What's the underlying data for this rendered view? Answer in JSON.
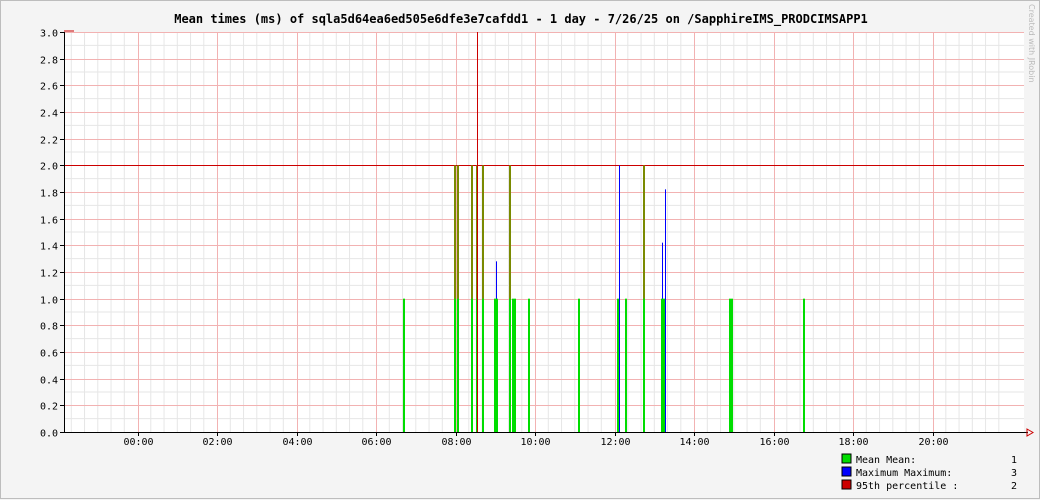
{
  "chart_data": {
    "type": "bar",
    "title": "Mean times (ms) of sqla5d64ea6ed505e6dfe3e7cafdd1 - 1 day - 7/26/25 on /SapphireIMS_PRODCIMSAPP1",
    "watermark": "Created with JRobin",
    "xlabel": "",
    "ylabel": "",
    "ylim": [
      0,
      3.0
    ],
    "xlim_hours": [
      -1.85,
      22.3
    ],
    "x_ticks": [
      "00:00",
      "02:00",
      "04:00",
      "06:00",
      "08:00",
      "10:00",
      "12:00",
      "14:00",
      "16:00",
      "18:00",
      "20:00"
    ],
    "y_ticks": [
      "0.0",
      "0.2",
      "0.4",
      "0.6",
      "0.8",
      "1.0",
      "1.2",
      "1.4",
      "1.6",
      "1.8",
      "2.0",
      "2.2",
      "2.4",
      "2.6",
      "2.8",
      "3.0"
    ],
    "grid": true,
    "threshold_line": 2.0,
    "series": [
      {
        "name": "Mean",
        "color": "#00dd00",
        "points": [
          {
            "t": 6.67,
            "v": 1
          },
          {
            "t": 7.97,
            "v": 2
          },
          {
            "t": 8.03,
            "v": 2
          },
          {
            "t": 8.4,
            "v": 2
          },
          {
            "t": 8.52,
            "v": 2
          },
          {
            "t": 8.67,
            "v": 2
          },
          {
            "t": 8.97,
            "v": 1
          },
          {
            "t": 9.02,
            "v": 1
          },
          {
            "t": 9.35,
            "v": 2
          },
          {
            "t": 9.42,
            "v": 1
          },
          {
            "t": 9.47,
            "v": 1
          },
          {
            "t": 9.83,
            "v": 1
          },
          {
            "t": 11.07,
            "v": 1
          },
          {
            "t": 12.07,
            "v": 1
          },
          {
            "t": 12.27,
            "v": 1
          },
          {
            "t": 12.72,
            "v": 2
          },
          {
            "t": 13.17,
            "v": 1
          },
          {
            "t": 13.22,
            "v": 1
          },
          {
            "t": 14.87,
            "v": 1
          },
          {
            "t": 14.92,
            "v": 1
          },
          {
            "t": 16.75,
            "v": 1
          }
        ]
      },
      {
        "name": "Maximum",
        "color": "#0000ff",
        "points": [
          {
            "t": 9.02,
            "v": 1.28
          },
          {
            "t": 12.1,
            "v": 2.0
          },
          {
            "t": 13.2,
            "v": 1.42
          },
          {
            "t": 13.27,
            "v": 1.82
          }
        ]
      },
      {
        "name": "95th percentile",
        "color": "#cc0000",
        "points": [
          {
            "t": 8.53,
            "v": 3.0
          }
        ]
      }
    ],
    "legend": [
      {
        "color": "#00dd00",
        "label": "Mean  Mean:",
        "value": "1"
      },
      {
        "color": "#0000ff",
        "label": "Maximum  Maximum:",
        "value": "3"
      },
      {
        "color": "#cc0000",
        "label": "95th percentile  :",
        "value": "2"
      }
    ]
  }
}
